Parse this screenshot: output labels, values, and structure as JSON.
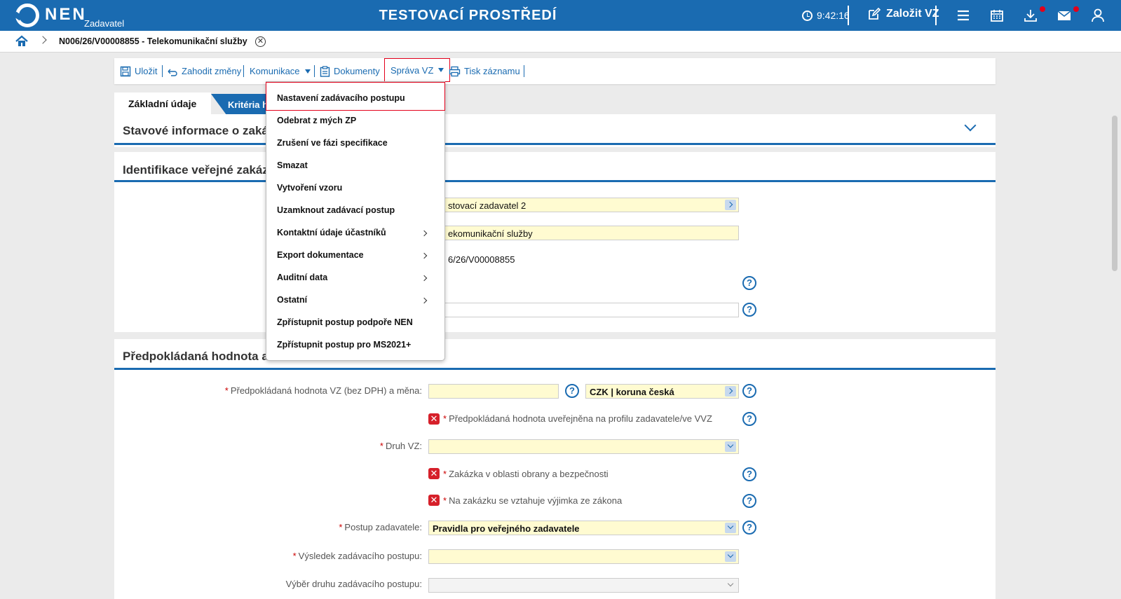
{
  "header": {
    "brand": "NEN",
    "brand_sub": "Zadavatel",
    "env_title": "TESTOVACÍ PROSTŘEDÍ",
    "clock": "9:42:16",
    "create_label": "Založit VZ"
  },
  "breadcrumb": {
    "title": "N006/26/V00008855 - Telekomunikační služby"
  },
  "toolbar": {
    "save": "Uložit",
    "discard": "Zahodit změny",
    "communication": "Komunikace",
    "documents": "Dokumenty",
    "management": "Správa VZ",
    "print": "Tisk záznamu"
  },
  "tabs": {
    "basic": "Základní údaje",
    "criteria": "Kritéria h"
  },
  "panels": {
    "status": "Stavové informace o zaká",
    "identification": "Identifikace veřejné zakáz",
    "estimated": "Předpokládaná hodnota a"
  },
  "identification_fields": {
    "contracting_authority": "stovací zadavatel 2",
    "name": "ekomunikační služby",
    "number": "6/26/V00008855"
  },
  "menu": {
    "items": [
      {
        "label": "Nastavení zadávacího postupu"
      },
      {
        "label": "Odebrat z mých ZP"
      },
      {
        "label": "Zrušení ve fázi specifikace"
      },
      {
        "label": "Smazat"
      },
      {
        "label": "Vytvoření vzoru"
      },
      {
        "label": "Uzamknout zadávací postup"
      },
      {
        "label": "Kontaktní údaje účastníků"
      },
      {
        "label": "Export dokumentace"
      },
      {
        "label": "Auditní data"
      },
      {
        "label": "Ostatní"
      },
      {
        "label": "Zpřístupnit postup podpoře NEN"
      },
      {
        "label": "Zpřístupnit postup pro MS2021+"
      }
    ]
  },
  "form": {
    "estimated_value_label": "Předpokládaná hodnota VZ (bez DPH) a měna:",
    "currency_value": "CZK | koruna česká",
    "published_label": "Předpokládaná hodnota uveřejněna na profilu zadavatele/ve VVZ",
    "type_label": "Druh VZ:",
    "defense_label": "Zakázka v oblasti obrany a bezpečnosti",
    "exception_label": "Na zakázku se vztahuje výjimka ze zákona",
    "procedure_label": "Postup zadavatele:",
    "procedure_value": "Pravidla pro veřejného zadavatele",
    "result_label": "Výsledek zadávacího postupu:",
    "selection_label": "Výběr druhu zadávacího postupu:"
  },
  "icons": {
    "help": "?",
    "unchecked": "✕",
    "close": "✕"
  },
  "colors": {
    "brand_blue": "#1a6bb1",
    "highlight_red": "#e3001b",
    "field_yellow": "#fffbd1"
  }
}
